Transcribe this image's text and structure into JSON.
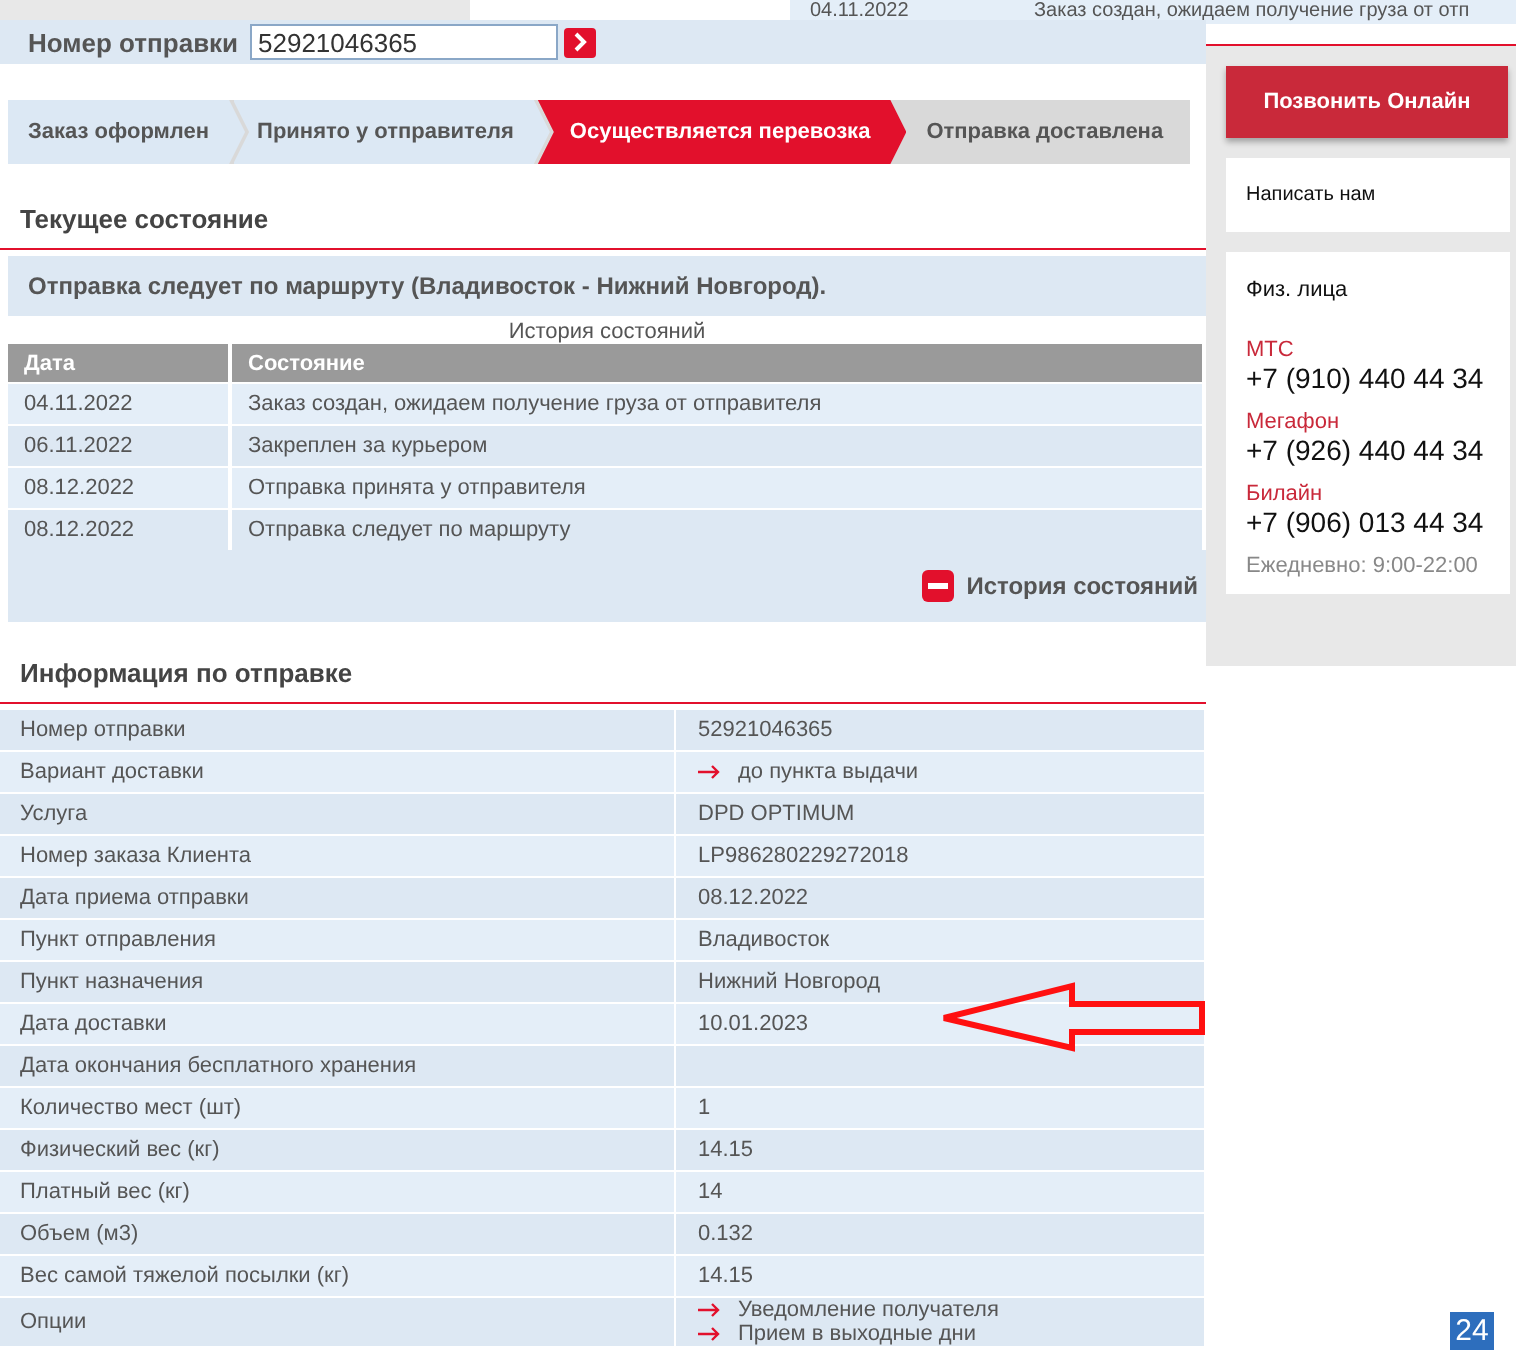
{
  "peek_row": {
    "date": "04.11.2022",
    "status": "Заказ создан, ожидаем получение груза от отп"
  },
  "search": {
    "label": "Номер отправки",
    "value": "52921046365"
  },
  "steps": [
    {
      "label": "Заказ оформлен",
      "selected": false
    },
    {
      "label": "Принято у отправителя",
      "selected": false
    },
    {
      "label": "Осуществляется перевозка",
      "selected": true
    },
    {
      "label": "Отправка доставлена",
      "selected": false
    }
  ],
  "current_state": {
    "heading": "Текущее состояние",
    "message": "Отправка следует по маршруту (Владивосток - Нижний Новгород).",
    "history_caption": "История состояний",
    "columns": [
      "Дата",
      "Состояние"
    ],
    "rows": [
      {
        "date": "04.11.2022",
        "status": "Заказ создан, ожидаем получение груза от отправителя"
      },
      {
        "date": "06.11.2022",
        "status": "Закреплен за курьером"
      },
      {
        "date": "08.12.2022",
        "status": "Отправка принята у отправителя"
      },
      {
        "date": "08.12.2022",
        "status": "Отправка следует по маршруту"
      }
    ],
    "toggle": {
      "label": "История состояний",
      "expanded": true
    }
  },
  "info": {
    "heading": "Информация по отправке",
    "rows": [
      {
        "label": "Номер отправки",
        "values": [
          {
            "text": "52921046365",
            "arrow": false
          }
        ]
      },
      {
        "label": "Вариант доставки",
        "values": [
          {
            "text": "до пункта выдачи",
            "arrow": true
          }
        ]
      },
      {
        "label": "Услуга",
        "values": [
          {
            "text": "DPD OPTIMUM",
            "arrow": false
          }
        ]
      },
      {
        "label": "Номер заказа Клиента",
        "values": [
          {
            "text": "LP986280229272018",
            "arrow": false
          }
        ]
      },
      {
        "label": "Дата приема отправки",
        "values": [
          {
            "text": "08.12.2022",
            "arrow": false
          }
        ]
      },
      {
        "label": "Пункт отправления",
        "values": [
          {
            "text": "Владивосток",
            "arrow": false
          }
        ]
      },
      {
        "label": "Пункт назначения",
        "values": [
          {
            "text": "Нижний Новгород",
            "arrow": false
          }
        ]
      },
      {
        "label": "Дата доставки",
        "values": [
          {
            "text": "10.01.2023",
            "arrow": false
          }
        ]
      },
      {
        "label": "Дата окончания бесплатного хранения"
      },
      {
        "label": "Количество мест (шт)",
        "values": [
          {
            "text": "1",
            "arrow": false
          }
        ]
      },
      {
        "label": "Физический вес (кг)",
        "values": [
          {
            "text": "14.15",
            "arrow": false
          }
        ]
      },
      {
        "label": "Платный вес (кг)",
        "values": [
          {
            "text": "14",
            "arrow": false
          }
        ]
      },
      {
        "label": "Объем (м3)",
        "values": [
          {
            "text": "0.132",
            "arrow": false
          }
        ]
      },
      {
        "label": "Вес самой тяжелой посылки (кг)",
        "values": [
          {
            "text": "14.15",
            "arrow": false
          }
        ]
      },
      {
        "label": "Опции",
        "values": [
          {
            "text": "Уведомление получателя",
            "arrow": true
          },
          {
            "text": "Прием в выходные дни",
            "arrow": true
          }
        ]
      }
    ]
  },
  "sidebar": {
    "call_button": "Позвонить Онлайн",
    "write_link": "Написать нам",
    "contacts_title": "Физ. лица",
    "phones": [
      {
        "operator": "МТС",
        "number": "+7 (910) 440 44 34"
      },
      {
        "operator": "Мегафон",
        "number": "+7 (926) 440 44 34"
      },
      {
        "operator": "Билайн",
        "number": "+7 (906) 013 44 34"
      }
    ],
    "hours": "Ежедневно: 9:00-22:00"
  },
  "badge": "24"
}
